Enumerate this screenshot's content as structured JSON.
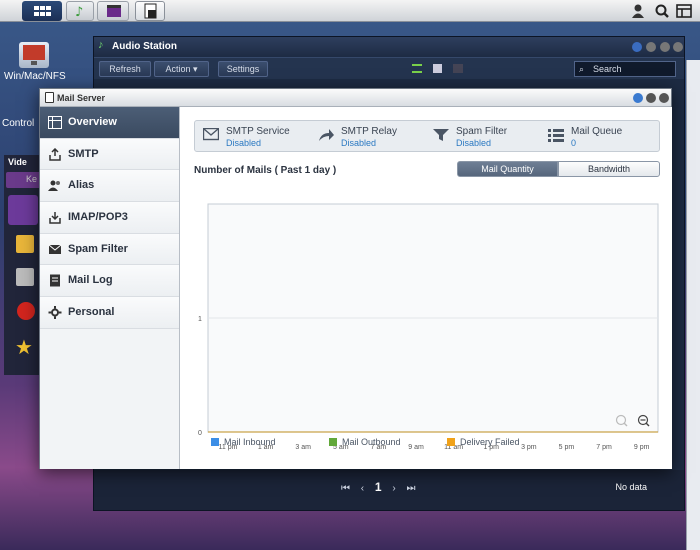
{
  "taskbar": {
    "icons": [
      "main-menu-icon",
      "audio-station-icon",
      "video-station-icon",
      "mail-server-icon"
    ],
    "right_icons": [
      "user-icon",
      "search-icon",
      "widgets-icon"
    ]
  },
  "desktop": {
    "icon1_label": "Win/Mac/NFS",
    "icon2_label": "Control",
    "video_label": "Vide",
    "search_partial": "Ke"
  },
  "audio_station": {
    "title": "Audio Station",
    "refresh": "Refresh",
    "action": "Action",
    "settings": "Settings",
    "search_placeholder": "Search",
    "pager_current": "1",
    "no_data": "No data"
  },
  "mail_server": {
    "title": "Mail Server",
    "sidebar": [
      {
        "label": "Overview",
        "icon": "overview-icon",
        "active": true
      },
      {
        "label": "SMTP",
        "icon": "smtp-icon",
        "active": false
      },
      {
        "label": "Alias",
        "icon": "alias-icon",
        "active": false
      },
      {
        "label": "IMAP/POP3",
        "icon": "imap-icon",
        "active": false
      },
      {
        "label": "Spam Filter",
        "icon": "spam-filter-icon",
        "active": false
      },
      {
        "label": "Mail Log",
        "icon": "mail-log-icon",
        "active": false
      },
      {
        "label": "Personal",
        "icon": "personal-icon",
        "active": false
      }
    ],
    "status": [
      {
        "title": "SMTP Service",
        "value": "Disabled",
        "icon": "mail-icon"
      },
      {
        "title": "SMTP Relay",
        "value": "Disabled",
        "icon": "relay-icon"
      },
      {
        "title": "Spam Filter",
        "value": "Disabled",
        "icon": "filter-icon"
      },
      {
        "title": "Mail Queue",
        "value": "0",
        "icon": "queue-icon"
      }
    ],
    "chart_heading": "Number of Mails ( Past 1 day )",
    "tab_quantity": "Mail Quantity",
    "tab_bandwidth": "Bandwidth"
  },
  "chart_data": {
    "type": "line",
    "x": [
      "11 pm",
      "1 am",
      "3 am",
      "5 am",
      "7 am",
      "9 am",
      "11 am",
      "1 pm",
      "3 pm",
      "5 pm",
      "7 pm",
      "9 pm"
    ],
    "ylim": [
      0,
      2
    ],
    "yticks": [
      0,
      1
    ],
    "grid": true,
    "legend_position": "bottom",
    "series": [
      {
        "name": "Mail Inbound",
        "color": "#3c8ee6",
        "values": []
      },
      {
        "name": "Mail Outbound",
        "color": "#62a83a",
        "values": []
      },
      {
        "name": "Delivery Failed",
        "color": "#f0a21a",
        "values": []
      }
    ]
  }
}
